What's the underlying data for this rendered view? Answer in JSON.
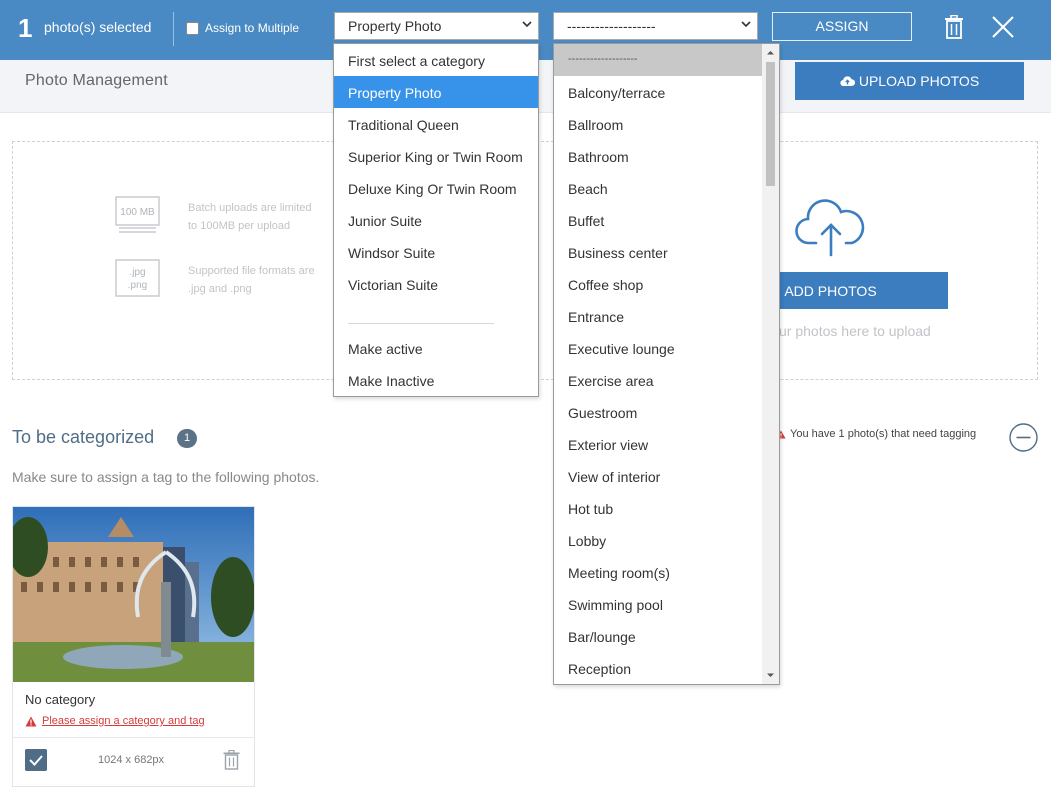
{
  "topbar": {
    "selected_count": "1",
    "selected_text": "photo(s) selected",
    "assign_multiple_label": "Assign to Multiple",
    "category_select_value": "Property Photo",
    "tag_select_value": "-------------------",
    "assign_label": "ASSIGN",
    "icons": [
      "trash-icon",
      "close-icon"
    ]
  },
  "header": {
    "title": "Photo Management",
    "upload_label": "UPLOAD PHOTOS",
    "upload_icon": "cloud-upload-icon"
  },
  "dropzone": {
    "size_icon_text": "100 MB",
    "size_text_1": "Batch uploads are limited",
    "size_text_2": "to 100MB per upload",
    "format_icon_text_1": ".jpg",
    "format_icon_text_2": ".png",
    "format_text_1": "Supported file formats are",
    "format_text_2": ".jpg and .png",
    "add_photos_label": "ADD PHOTOS",
    "drag_text": "Drag your photos here to upload"
  },
  "categorize": {
    "title": "To be categorized",
    "count": "1",
    "hint": "Make sure to assign a tag to the following photos.",
    "tagging_warning": "You have 1 photo(s) that need tagging"
  },
  "photo_card": {
    "category": "No category",
    "assign_warning": "Please assign a category and tag",
    "dimensions": "1024 x 682px",
    "checked": true
  },
  "category_menu": {
    "options": [
      "First select a category",
      "Property Photo",
      "Traditional Queen",
      "Superior King or Twin Room",
      "Deluxe King Or Twin Room",
      "Junior Suite",
      "Windsor Suite",
      "Victorian Suite"
    ],
    "active_index": 1,
    "actions": [
      "Make active",
      "Make Inactive"
    ]
  },
  "tag_menu": {
    "options": [
      "-------------------",
      "Balcony/terrace",
      "Ballroom",
      "Bathroom",
      "Beach",
      "Buffet",
      "Business center",
      "Coffee shop",
      "Entrance",
      "Executive lounge",
      "Exercise area",
      "Guestroom",
      "Exterior view",
      "View of interior",
      "Hot tub",
      "Lobby",
      "Meeting room(s)",
      "Swimming pool",
      "Bar/lounge",
      "Reception"
    ],
    "highlighted_index": 0
  },
  "colors": {
    "topbar": "#4a8ac4",
    "primary_button": "#3b7dbf",
    "menu_highlight": "#3793ea",
    "warning": "#d43c3c",
    "heading": "#4f6d86"
  }
}
